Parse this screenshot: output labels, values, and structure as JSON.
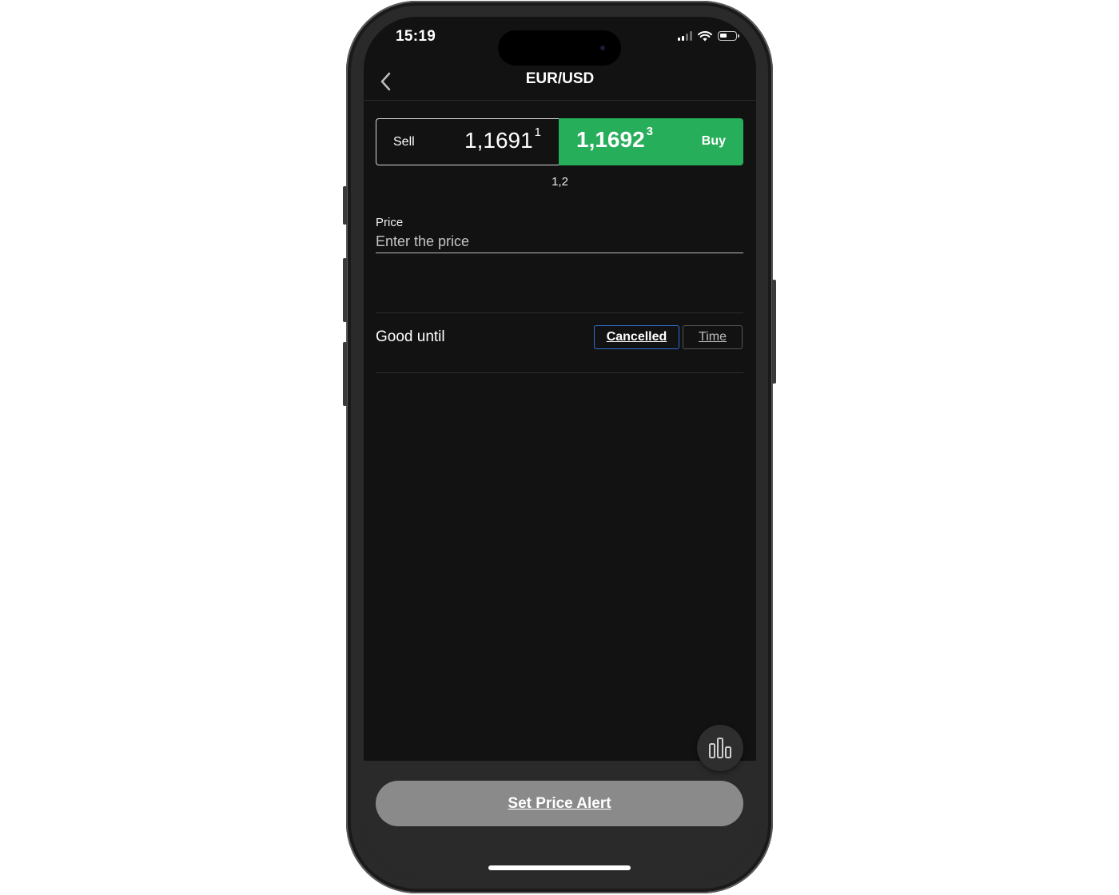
{
  "status_bar": {
    "time": "15:19"
  },
  "nav": {
    "title": "EUR/USD"
  },
  "quote": {
    "sell_label": "Sell",
    "sell_price": "1,1691",
    "sell_pip": "1",
    "buy_label": "Buy",
    "buy_price": "1,1692",
    "buy_pip": "3",
    "spread": "1,2"
  },
  "price_field": {
    "label": "Price",
    "placeholder": "Enter the price"
  },
  "good_until": {
    "label": "Good until",
    "options": [
      "Cancelled",
      "Time"
    ],
    "selected": "Cancelled"
  },
  "cta": {
    "label": "Set Price Alert"
  },
  "colors": {
    "buy": "#27ae5a",
    "selected_border": "#2f6fd3",
    "background": "#121212",
    "cta": "#8a8a8a"
  },
  "icons": {
    "back": "chevron-left-icon",
    "chart": "bar-chart-icon"
  }
}
